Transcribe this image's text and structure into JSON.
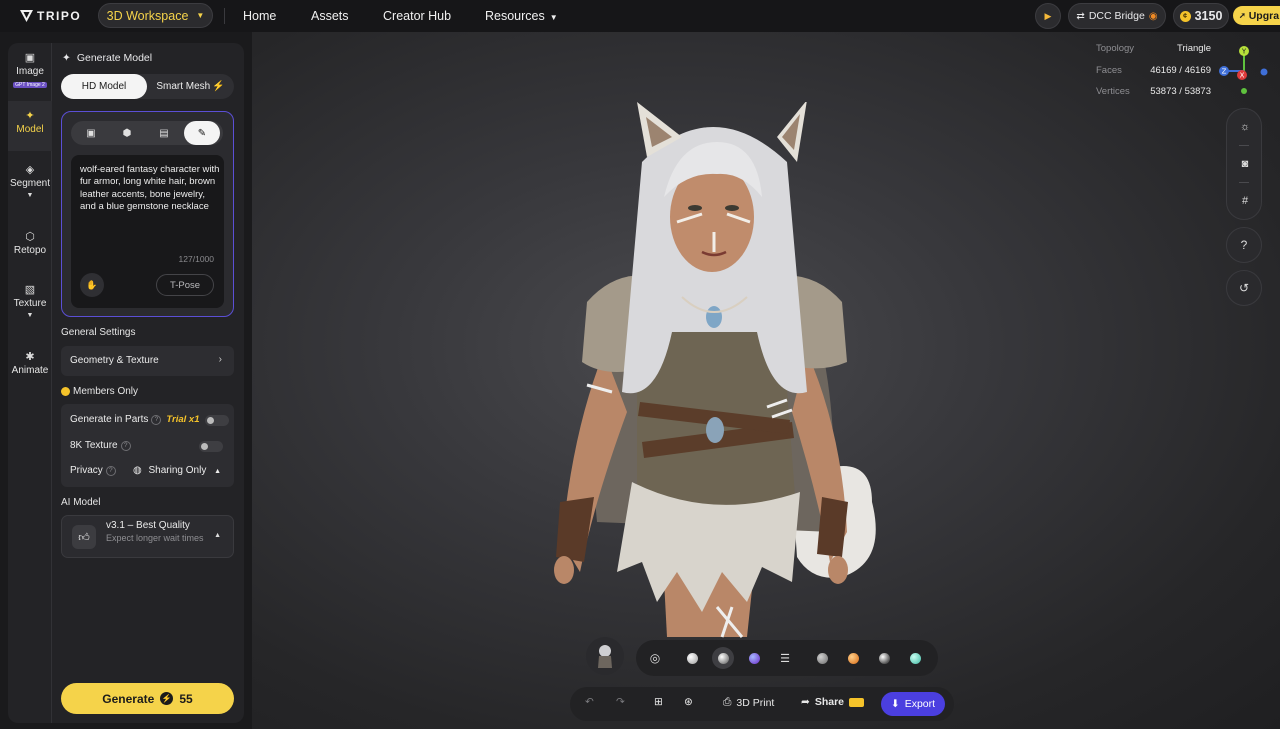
{
  "header": {
    "logo_text": "TRIPO",
    "workspace_label": "3D Workspace",
    "nav": [
      "Home",
      "Assets",
      "Creator Hub",
      "Resources"
    ],
    "dcc_label": "DCC Bridge",
    "credits": "3150",
    "upgrade_label": "Upgra"
  },
  "rail": {
    "items": [
      {
        "label": "Image",
        "badge": "GPT Image 2"
      },
      {
        "label": "Model"
      },
      {
        "label": "Segment"
      },
      {
        "label": "Retopo"
      },
      {
        "label": "Texture"
      },
      {
        "label": "Animate"
      }
    ]
  },
  "panel": {
    "title": "Generate Model",
    "mode_hd": "HD Model",
    "mode_smart": "Smart Mesh",
    "prompt": "wolf-eared fantasy character with fur armor, long white hair, brown leather accents, bone jewelry, and a blue gemstone necklace",
    "char_count": "127/1000",
    "tpose_label": "T-Pose",
    "general_settings": "General Settings",
    "geometry_texture": "Geometry & Texture",
    "members_only": "Members Only",
    "generate_in_parts": "Generate in Parts",
    "trial": "Trial x1",
    "texture_8k": "8K Texture",
    "privacy": "Privacy",
    "privacy_value": "Sharing Only",
    "ai_model_label": "AI Model",
    "ai_model_name": "v3.1 – Best Quality",
    "ai_model_sub": "Expect longer wait times",
    "generate_label": "Generate",
    "generate_cost": "55"
  },
  "viewport": {
    "stats": [
      {
        "key": "Topology",
        "value": "Triangle"
      },
      {
        "key": "Faces",
        "value": "46169 / 46169"
      },
      {
        "key": "Vertices",
        "value": "53873 / 53873"
      }
    ],
    "axis_labels": {
      "y": "Y",
      "z": "Z",
      "x": "X"
    },
    "bottom": {
      "print_label": "3D Print",
      "share_label": "Share",
      "export_label": "Export"
    }
  },
  "colors": {
    "accent_yellow": "#f5d34a",
    "export_blue": "#4b3fe0",
    "prompt_border": "#5b4fd6"
  }
}
